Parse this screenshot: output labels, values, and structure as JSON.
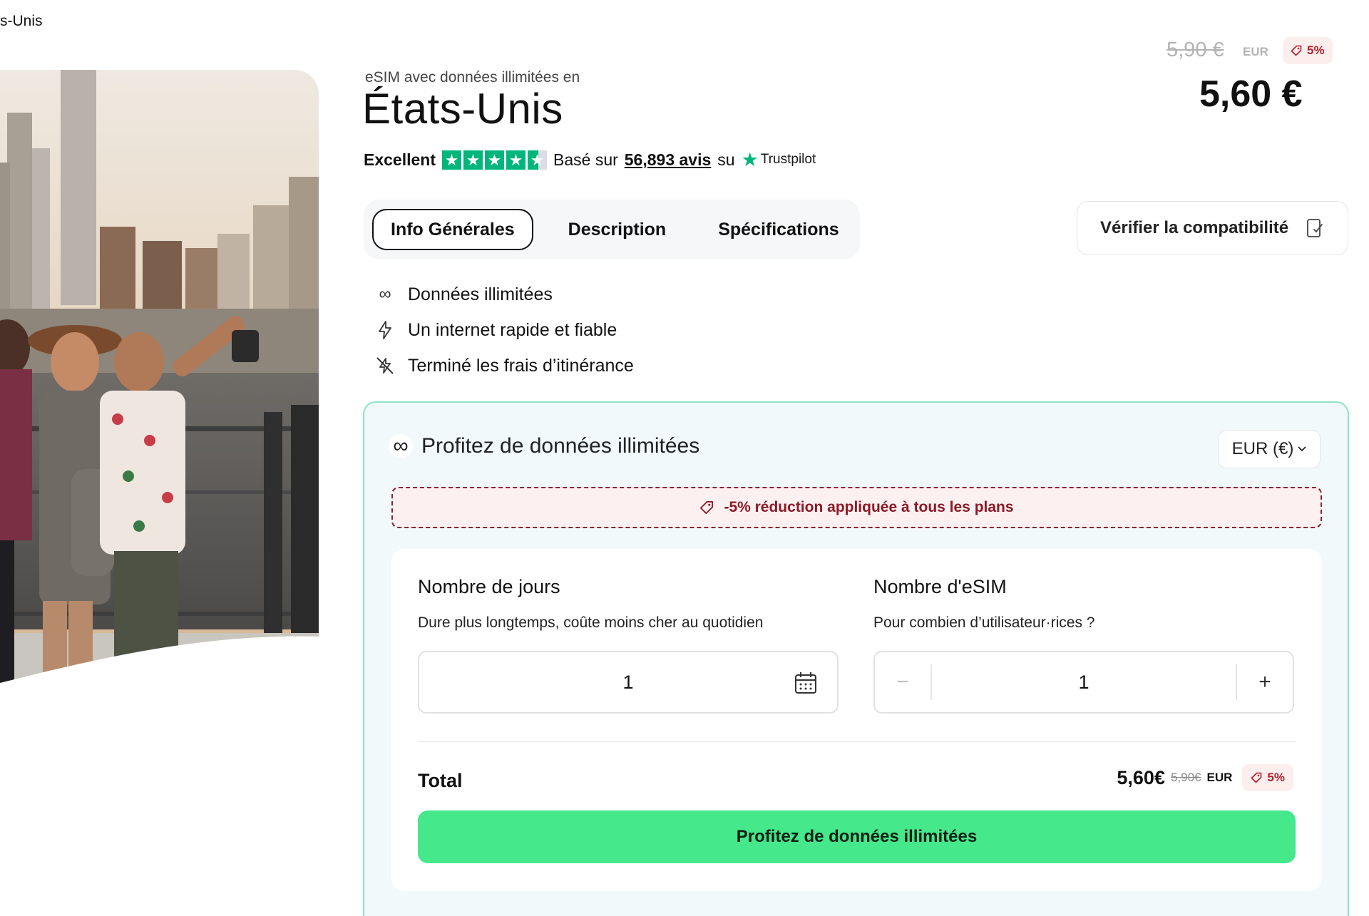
{
  "breadcrumb": {
    "text": "s-Unis"
  },
  "hero": {
    "alt": "Group of friends taking a selfie in front of the New York skyline"
  },
  "product": {
    "subtitle": "eSIM avec données illimitées en",
    "title": "États-Unis",
    "rating": {
      "label": "Excellent",
      "stars": 4.5,
      "based_on": "Basé sur",
      "reviews_link": "56,893 avis",
      "on": "su",
      "provider": "Trustpilot"
    }
  },
  "price": {
    "old": "5,90 €",
    "old_currency": "EUR",
    "badge": "5%",
    "current": "5,60 €"
  },
  "tabs": [
    {
      "label": "Info Générales",
      "active": true
    },
    {
      "label": "Description",
      "active": false
    },
    {
      "label": "Spécifications",
      "active": false
    }
  ],
  "compat_button": {
    "label": "Vérifier la compatibilité"
  },
  "features": [
    {
      "icon": "infinity-icon",
      "label": "Données illimitées"
    },
    {
      "icon": "lightning-icon",
      "label": "Un internet rapide et fiable"
    },
    {
      "icon": "no-roaming-icon",
      "label": "Terminé les frais d’itinérance"
    }
  ],
  "panel": {
    "heading": "Profitez de données illimitées",
    "currency_selector": "EUR (€)",
    "discount_text": "-5% réduction appliquée à tous les plans",
    "days": {
      "title": "Nombre de jours",
      "description": "Dure plus longtemps, coûte moins cher au quotidien",
      "value": "1"
    },
    "esims": {
      "title": "Nombre d'eSIM",
      "description": "Pour combien d’utilisateur·rices ?",
      "value": "1",
      "minus": "−",
      "plus": "+"
    },
    "total": {
      "label": "Total",
      "now": "5,60€",
      "was": "5,90€",
      "currency": "EUR",
      "badge": "5%"
    },
    "cta": "Profitez de données illimitées"
  },
  "colors": {
    "accent_green": "#45e88a",
    "trustpilot_green": "#00b67a",
    "discount_red": "#b4202c",
    "panel_border": "#8ee3c3"
  }
}
